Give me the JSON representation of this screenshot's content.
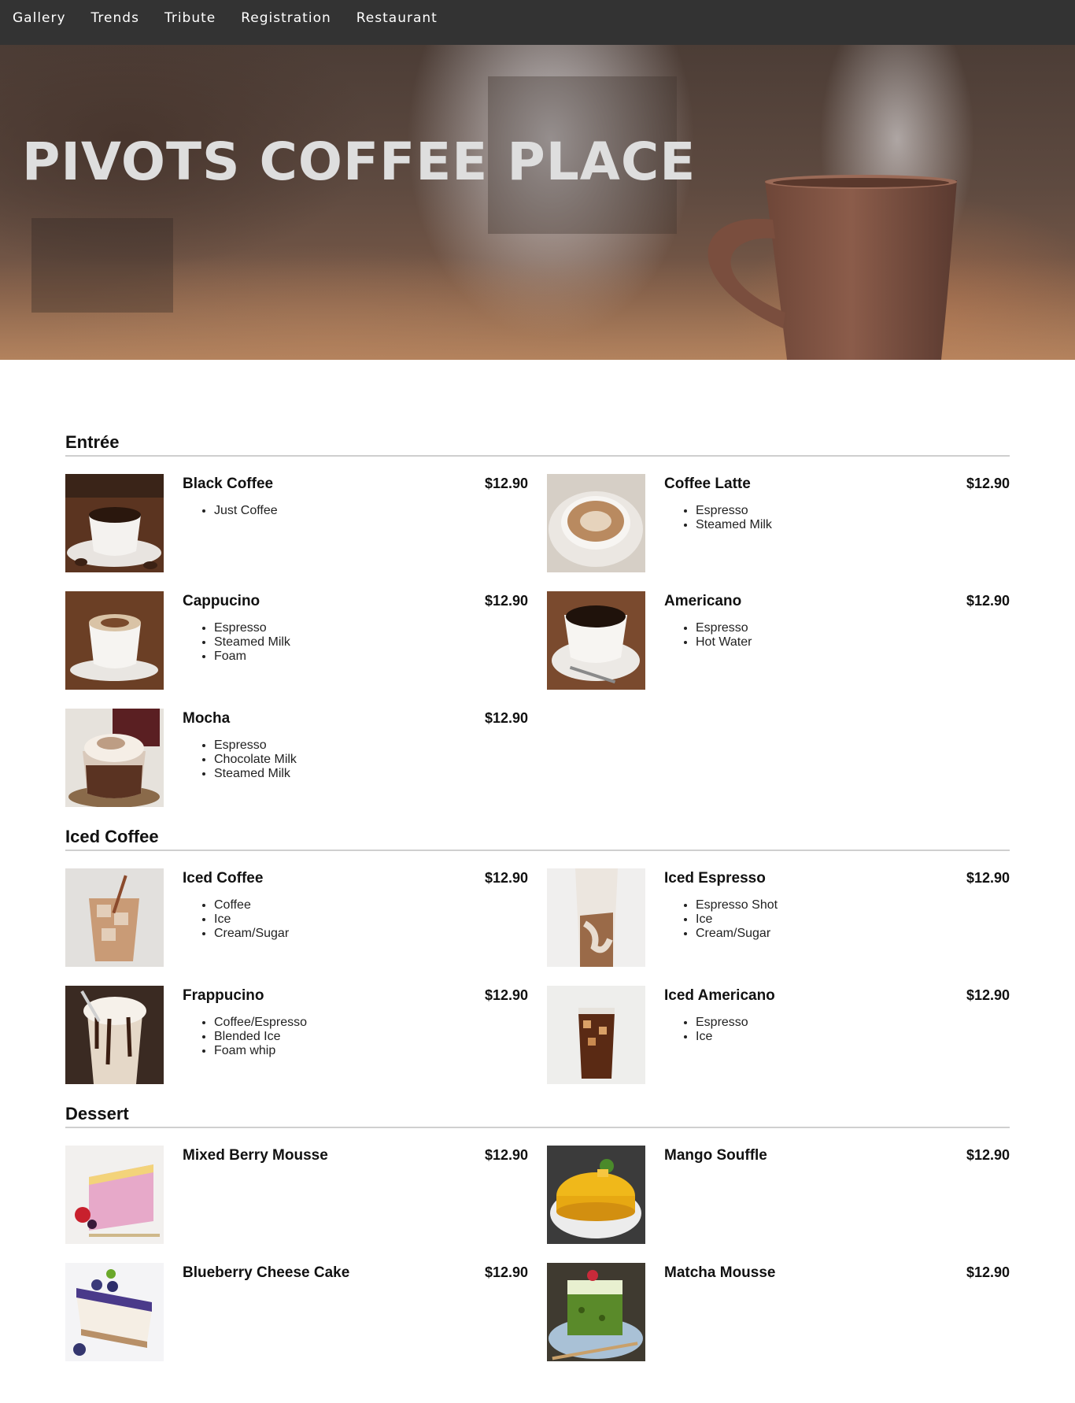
{
  "nav": [
    "Gallery",
    "Trends",
    "Tribute",
    "Registration",
    "Restaurant"
  ],
  "hero": {
    "title": "PIVOTS COFFEE PLACE"
  },
  "colors": {
    "nav_bg": "#333333",
    "nav_text": "#ffffff",
    "title_text": "#dedede",
    "divider": "#cfcfcf"
  },
  "sections": [
    {
      "title": "Entrée",
      "items": [
        {
          "name": "Black Coffee",
          "price": "$12.90",
          "ingredients": [
            "Just Coffee"
          ],
          "image": "black-coffee"
        },
        {
          "name": "Coffee Latte",
          "price": "$12.90",
          "ingredients": [
            "Espresso",
            "Steamed Milk"
          ],
          "image": "latte"
        },
        {
          "name": "Cappucino",
          "price": "$12.90",
          "ingredients": [
            "Espresso",
            "Steamed Milk",
            "Foam"
          ],
          "image": "cappucino"
        },
        {
          "name": "Americano",
          "price": "$12.90",
          "ingredients": [
            "Espresso",
            "Hot Water"
          ],
          "image": "americano"
        },
        {
          "name": "Mocha",
          "price": "$12.90",
          "ingredients": [
            "Espresso",
            "Chocolate Milk",
            "Steamed Milk"
          ],
          "image": "mocha"
        }
      ]
    },
    {
      "title": "Iced Coffee",
      "items": [
        {
          "name": "Iced Coffee",
          "price": "$12.90",
          "ingredients": [
            "Coffee",
            "Ice",
            "Cream/Sugar"
          ],
          "image": "iced-coffee"
        },
        {
          "name": "Iced Espresso",
          "price": "$12.90",
          "ingredients": [
            "Espresso Shot",
            "Ice",
            "Cream/Sugar"
          ],
          "image": "iced-espresso"
        },
        {
          "name": "Frappucino",
          "price": "$12.90",
          "ingredients": [
            "Coffee/Espresso",
            "Blended Ice",
            "Foam whip"
          ],
          "image": "frappucino"
        },
        {
          "name": "Iced Americano",
          "price": "$12.90",
          "ingredients": [
            "Espresso",
            "Ice"
          ],
          "image": "iced-americano"
        }
      ]
    },
    {
      "title": "Dessert",
      "items": [
        {
          "name": "Mixed Berry Mousse",
          "price": "$12.90",
          "ingredients": [],
          "image": "berry-mousse"
        },
        {
          "name": "Mango Souffle",
          "price": "$12.90",
          "ingredients": [],
          "image": "mango-souffle"
        },
        {
          "name": "Blueberry Cheese Cake",
          "price": "$12.90",
          "ingredients": [],
          "image": "blueberry-cake"
        },
        {
          "name": "Matcha Mousse",
          "price": "$12.90",
          "ingredients": [],
          "image": "matcha-mousse"
        }
      ]
    }
  ]
}
